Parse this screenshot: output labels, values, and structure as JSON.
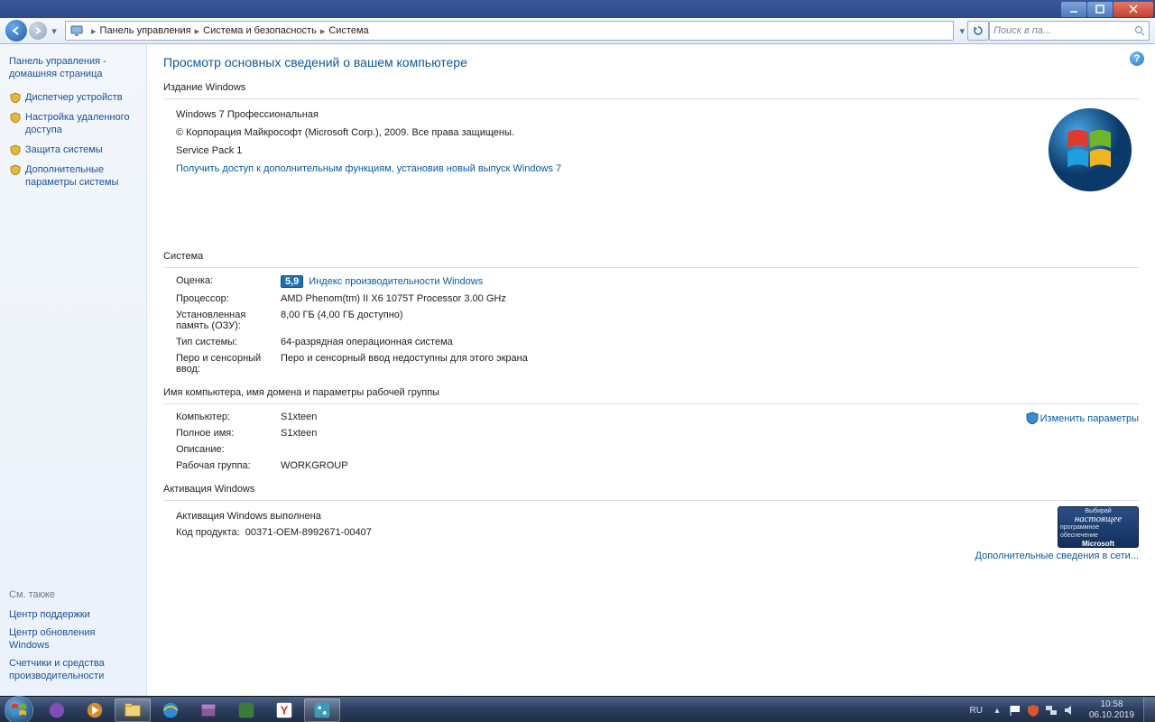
{
  "titlebar": {
    "min": "–",
    "max": "□",
    "close": "×"
  },
  "nav": {
    "breadcrumb": [
      "Панель управления",
      "Система и безопасность",
      "Система"
    ],
    "refresh_title": "Обновить",
    "search_placeholder": "Поиск в па..."
  },
  "sidebar": {
    "home": "Панель управления - домашняя страница",
    "links": [
      "Диспетчер устройств",
      "Настройка удаленного доступа",
      "Защита системы",
      "Дополнительные параметры системы"
    ],
    "see_also_title": "См. также",
    "see_also": [
      "Центр поддержки",
      "Центр обновления Windows",
      "Счетчики и средства производительности"
    ]
  },
  "content": {
    "heading": "Просмотр основных сведений о вашем компьютере",
    "help": "?",
    "edition": {
      "title": "Издание Windows",
      "product": "Windows 7 Профессиональная",
      "copyright": "© Корпорация Майкрософт (Microsoft Corp.), 2009. Все права защищены.",
      "sp": "Service Pack 1",
      "upsell": "Получить доступ к дополнительным функциям, установив новый выпуск Windows 7"
    },
    "system": {
      "title": "Система",
      "rows": [
        {
          "k": "Оценка:",
          "score": "5,9",
          "link": "Индекс производительности Windows"
        },
        {
          "k": "Процессор:",
          "v": "AMD Phenom(tm) II X6 1075T Processor   3.00 GHz"
        },
        {
          "k": "Установленная память (ОЗУ):",
          "v": "8,00 ГБ (4,00 ГБ доступно)"
        },
        {
          "k": "Тип системы:",
          "v": "64-разрядная операционная система"
        },
        {
          "k": "Перо и сенсорный ввод:",
          "v": "Перо и сенсорный ввод недоступны для этого экрана"
        }
      ]
    },
    "id": {
      "title": "Имя компьютера, имя домена и параметры рабочей группы",
      "rows": [
        {
          "k": "Компьютер:",
          "v": "S1xteen"
        },
        {
          "k": "Полное имя:",
          "v": "S1xteen"
        },
        {
          "k": "Описание:",
          "v": ""
        },
        {
          "k": "Рабочая группа:",
          "v": "WORKGROUP"
        }
      ],
      "change": "Изменить параметры"
    },
    "activation": {
      "title": "Активация Windows",
      "status": "Активация Windows выполнена",
      "pid_label": "Код продукта:",
      "pid": "00371-OEM-8992671-00407",
      "badge": {
        "l1": "Выбирай",
        "l2": "настоящее",
        "l3": "программное обеспечение",
        "l4": "Microsoft"
      },
      "netlink": "Дополнительные сведения в сети..."
    }
  },
  "taskbar": {
    "lang": "RU",
    "time": "10:58",
    "date": "06.10.2019"
  }
}
